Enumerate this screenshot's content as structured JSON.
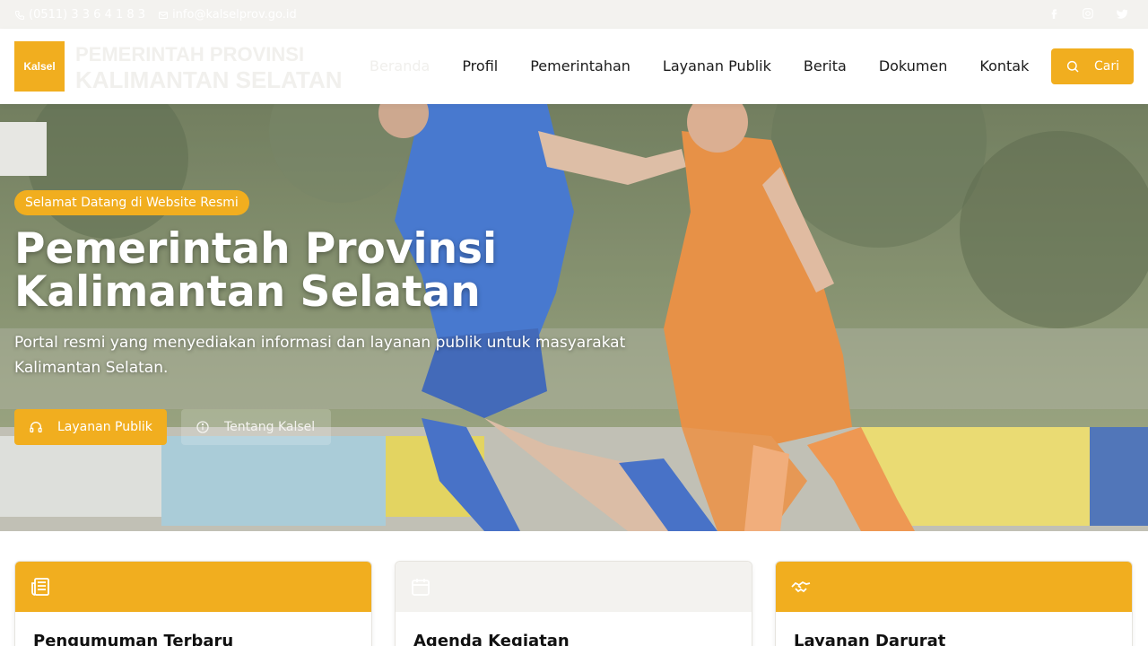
{
  "colors": {
    "accent": "#f1ae1f",
    "text": "#1b1b1b",
    "topbar_bg": "#f3f2ef"
  },
  "topbar": {
    "phone": "(0511) 3 3 6 4 1 8 3",
    "email": "info@kalselprov.go.id",
    "socials": [
      "facebook-icon",
      "instagram-icon",
      "twitter-icon"
    ]
  },
  "header": {
    "logo_text": "Kalsel",
    "brand_line1": "PEMERINTAH PROVINSI",
    "brand_line2": "KALIMANTAN SELATAN",
    "nav": [
      "Beranda",
      "Profil",
      "Pemerintahan",
      "Layanan Publik",
      "Berita",
      "Dokumen",
      "Kontak"
    ],
    "search_label": "Cari"
  },
  "hero": {
    "badge": "Selamat Datang di Website Resmi",
    "title_line1": "Pemerintah Provinsi",
    "title_line2": "Kalimantan Selatan",
    "subtitle": "Portal resmi yang menyediakan informasi dan layanan publik untuk masyarakat Kalimantan Selatan.",
    "btn_primary": "Layanan Publik",
    "btn_primary_icon": "headset-icon",
    "btn_secondary": "Tentang Kalsel",
    "btn_secondary_icon": "info-icon"
  },
  "cards": [
    {
      "title": "Pengumuman Terbaru",
      "icon": "newspaper-icon"
    },
    {
      "title": "Agenda Kegiatan",
      "icon": "calendar-icon"
    },
    {
      "title": "Layanan Darurat",
      "icon": "handshake-icon"
    }
  ]
}
